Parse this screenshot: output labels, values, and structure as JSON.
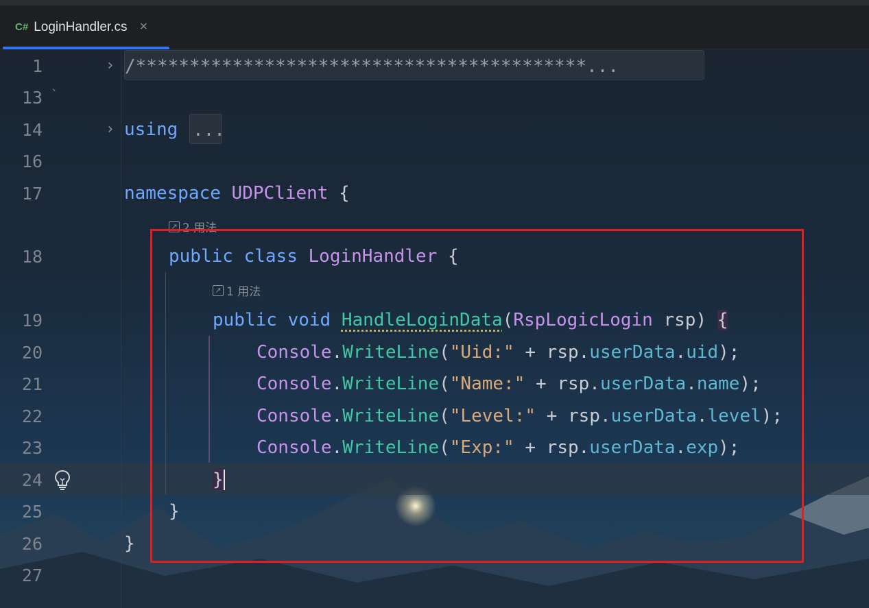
{
  "tab": {
    "lang": "C#",
    "filename": "LoginHandler.cs",
    "close": "×"
  },
  "gutter": {
    "lines": [
      "1",
      "13",
      "14",
      "16",
      "17",
      "18",
      "19",
      "20",
      "21",
      "22",
      "23",
      "24",
      "25",
      "26",
      "27"
    ]
  },
  "code": {
    "line1_comment": "/******************************************...",
    "line13_stray": "`",
    "using_kw": "using",
    "using_fold": "...",
    "namespace_kw": "namespace",
    "namespace_name": "UDPClient",
    "open_brace": "{",
    "close_brace": "}",
    "class_usages": "2 用法",
    "public_kw": "public",
    "class_kw": "class",
    "class_name": "LoginHandler",
    "method_usages": "1 用法",
    "void_kw": "void",
    "method_name": "HandleLoginData",
    "param_type": "RspLogicLogin",
    "param_name": "rsp",
    "console": "Console",
    "writeline": "WriteLine",
    "rsp": "rsp",
    "userData": "userData",
    "lines": [
      {
        "str": "\"Uid:\"",
        "field": "uid"
      },
      {
        "str": "\"Name:\"",
        "field": "name"
      },
      {
        "str": "\"Level:\"",
        "field": "level"
      },
      {
        "str": "\"Exp:\"",
        "field": "exp"
      }
    ]
  },
  "colors": {
    "keyword": "#6ea8ff",
    "type": "#c792ea",
    "method": "#41c7a4",
    "string": "#d9a978",
    "field": "#5fb8d3",
    "highlight_box": "#e02020",
    "tab_underline": "#3574f0"
  },
  "icons": {
    "fold": "chevron-right-icon",
    "intention": "lightbulb-icon",
    "usages": "external-link-icon"
  }
}
